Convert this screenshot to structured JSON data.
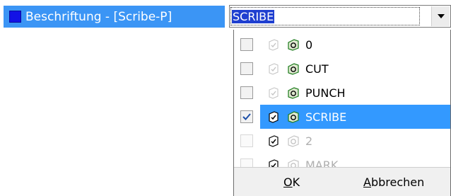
{
  "property": {
    "label": "Beschriftung - [Scribe-P]",
    "swatch_color": "#1212e6"
  },
  "combo": {
    "value": "SCRIBE",
    "dropdown_icon": "chevron-down-icon"
  },
  "layers": [
    {
      "name": "0",
      "checked": false,
      "enabled": true,
      "selected": false
    },
    {
      "name": "CUT",
      "checked": false,
      "enabled": true,
      "selected": false
    },
    {
      "name": "PUNCH",
      "checked": false,
      "enabled": true,
      "selected": false
    },
    {
      "name": "SCRIBE",
      "checked": true,
      "enabled": true,
      "selected": true
    },
    {
      "name": "2",
      "checked": false,
      "enabled": false,
      "selected": false
    },
    {
      "name": "MARK",
      "checked": false,
      "enabled": false,
      "selected": false
    }
  ],
  "buttons": {
    "ok_mnemonic": "O",
    "ok_rest": "K",
    "cancel_first": "A",
    "cancel_rest": "bbrechen"
  },
  "colors": {
    "selection": "#3399ff",
    "label_bg": "#3b95f5",
    "layer_icon_green": "#1a8a1a"
  }
}
